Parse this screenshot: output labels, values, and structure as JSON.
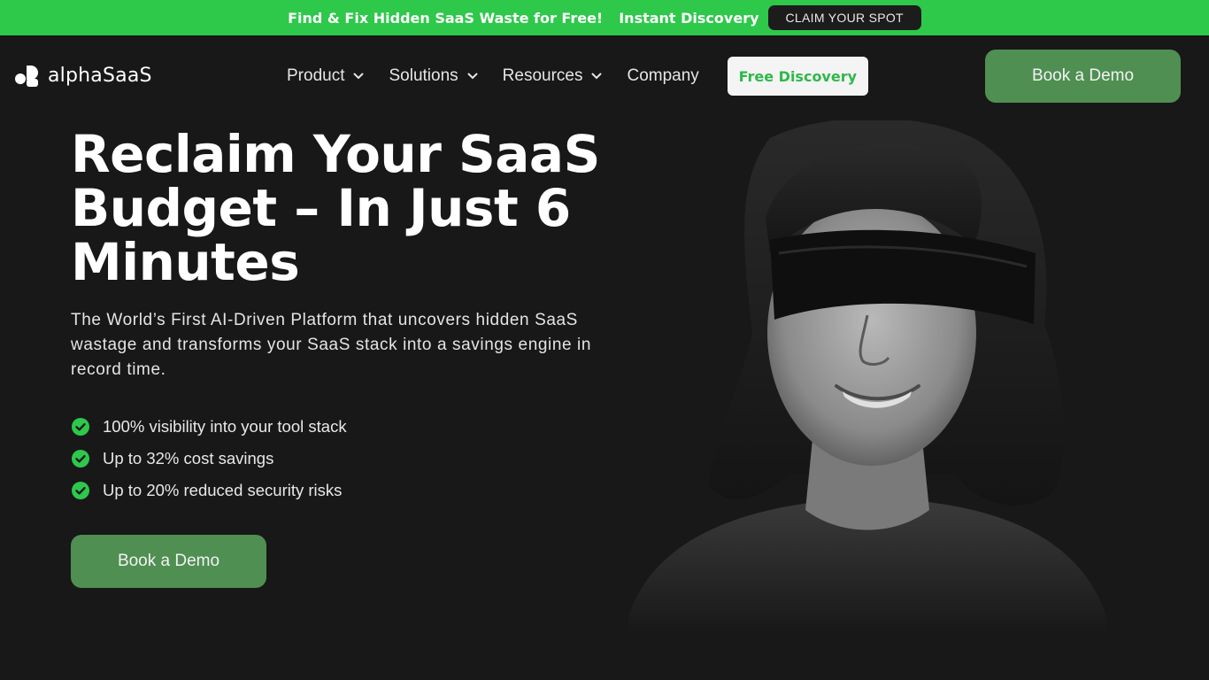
{
  "promo": {
    "headline": "Find & Fix Hidden SaaS Waste for Free!",
    "tagline": "Instant Discovery",
    "cta_label": "CLAIM YOUR SPOT"
  },
  "nav": {
    "logo_text": "alphaSaaS",
    "items": [
      {
        "label": "Product",
        "icon": "chevron-down-icon"
      },
      {
        "label": "Solutions",
        "icon": "chevron-down-icon"
      },
      {
        "label": "Resources",
        "icon": "chevron-down-icon"
      },
      {
        "label": "Company"
      }
    ],
    "free_discovery_label": "Free Discovery",
    "demo_label": "Book a Demo"
  },
  "hero": {
    "title": "Reclaim Your SaaS Budget – In Just 6 Minutes",
    "subtitle": "The World’s First AI-Driven Platform that uncovers hidden SaaS wastage and transforms your SaaS stack into a savings engine in record time.",
    "bullets": [
      "100% visibility into your tool stack",
      "Up to 32% cost savings",
      "Up to 20% reduced security risks"
    ],
    "cta_label": "Book a Demo",
    "bullet_icon": "check-circle-icon"
  },
  "colors": {
    "background": "#181818",
    "promo_green": "#2ec84a",
    "button_green": "#4f8f52",
    "check_green": "#2ec84a"
  }
}
